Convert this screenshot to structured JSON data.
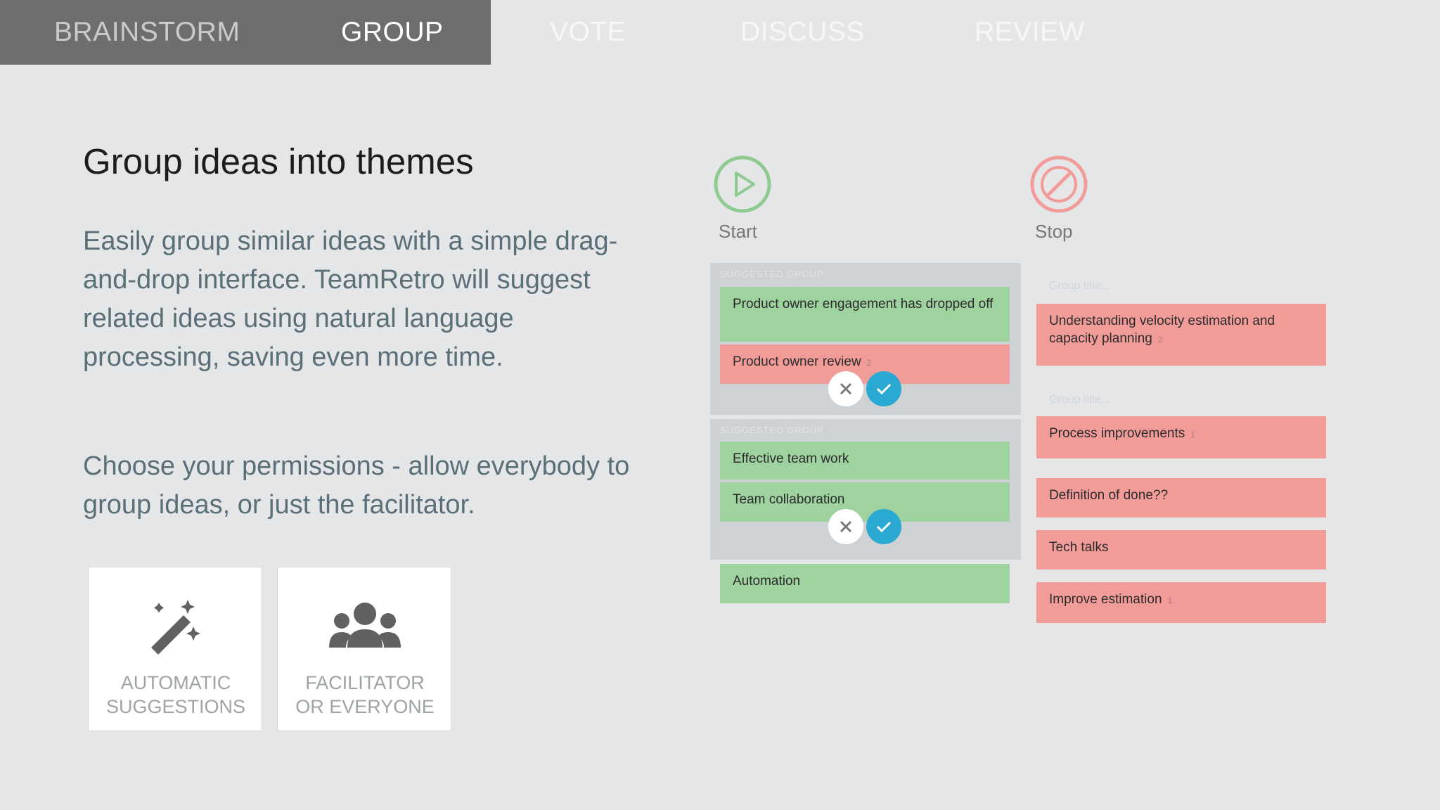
{
  "tabs": [
    {
      "label": "BRAINSTORM",
      "state": "previous"
    },
    {
      "label": "GROUP",
      "state": "active"
    },
    {
      "label": "VOTE",
      "state": "upcoming"
    },
    {
      "label": "DISCUSS",
      "state": "upcoming"
    },
    {
      "label": "REVIEW",
      "state": "upcoming"
    }
  ],
  "main": {
    "heading": "Group ideas into themes",
    "paragraph1": "Easily group similar ideas with a simple drag-and-drop interface. TeamRetro will suggest related ideas using natural language processing, saving even more time.",
    "paragraph2": "Choose your permissions - allow everybody to group ideas, or just the facilitator."
  },
  "features": [
    {
      "icon": "magic-wand-icon",
      "label": "AUTOMATIC\nSUGGESTIONS"
    },
    {
      "icon": "group-people-icon",
      "label": "FACILITATOR\nOR EVERYONE"
    }
  ],
  "board": {
    "columns": [
      {
        "title": "Start",
        "icon": "play-circle-icon",
        "color": "#8fcb90"
      },
      {
        "title": "Stop",
        "icon": "stop-circle-icon",
        "color": "#f29c9a"
      }
    ],
    "suggested_group_label": "SUGGESTED GROUP",
    "group_title_placeholder": "Group title...",
    "start_cards": {
      "group1": [
        "Product owner engagement has dropped off",
        "Product owner review"
      ],
      "group1_count": "2",
      "group2": [
        "Effective team work",
        "Team collaboration"
      ],
      "single": "Automation"
    },
    "stop_cards": {
      "group1": "Understanding velocity estimation and capacity planning",
      "group1_count": "2",
      "group2": "Process improvements",
      "group2_count": "1",
      "singles": [
        "Definition of done??",
        "Tech talks",
        "Improve estimation"
      ],
      "last_count": "1"
    },
    "colors": {
      "green_card": "#9ed39f",
      "red_card": "#f29c9a",
      "accept": "#2aa9d2"
    }
  }
}
